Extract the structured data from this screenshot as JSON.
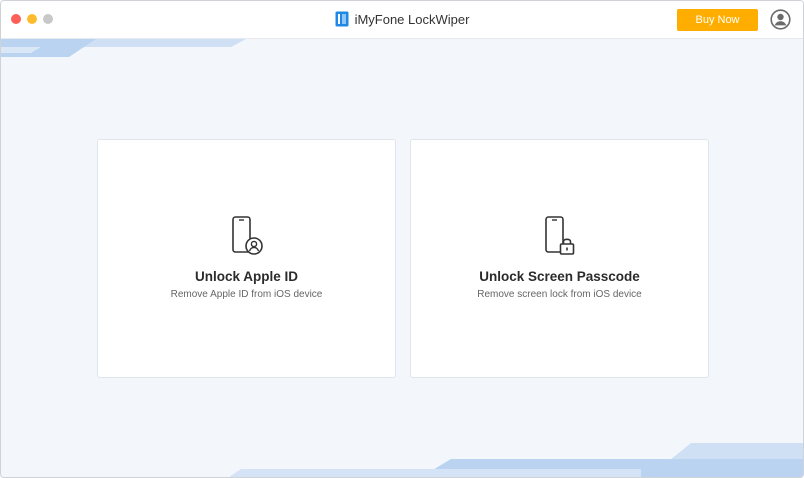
{
  "window": {
    "title": "iMyFone LockWiper",
    "buy_label": "Buy Now"
  },
  "icons": {
    "logo": "lockwiper-logo-icon",
    "account": "user-account-icon",
    "card1": "phone-person-icon",
    "card2": "phone-lock-icon"
  },
  "colors": {
    "buy_button": "#ffae00",
    "accent_blue": "#1e88e5",
    "background": "#f3f7fc"
  },
  "options": [
    {
      "title": "Unlock Apple ID",
      "subtitle": "Remove Apple ID from iOS device"
    },
    {
      "title": "Unlock Screen Passcode",
      "subtitle": "Remove screen lock from iOS device"
    }
  ]
}
